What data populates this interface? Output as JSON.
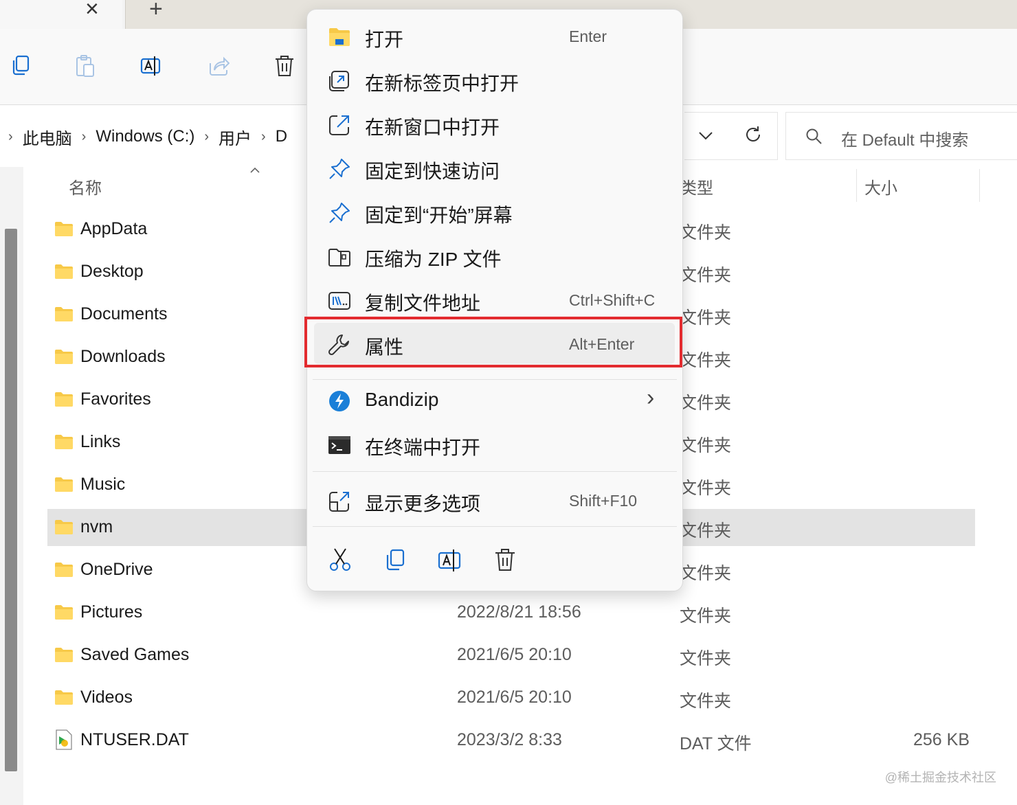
{
  "tabs": {
    "new_tab_symbol": "+",
    "close_symbol": "×"
  },
  "toolbar": {
    "icons": [
      "copy-icon",
      "paste-icon",
      "rename-icon",
      "share-icon",
      "delete-icon"
    ]
  },
  "address": {
    "crumbs": [
      "此电脑",
      "Windows (C:)",
      "用户",
      "D"
    ],
    "separator": "›",
    "search_placeholder": "在 Default 中搜索"
  },
  "columns": {
    "name": "名称",
    "type": "类型",
    "size": "大小"
  },
  "rows": [
    {
      "name": "AppData",
      "date": "",
      "type": "文件夹",
      "size": ""
    },
    {
      "name": "Desktop",
      "date": "",
      "type": "文件夹",
      "size": ""
    },
    {
      "name": "Documents",
      "date": "",
      "type": "文件夹",
      "size": ""
    },
    {
      "name": "Downloads",
      "date": "",
      "type": "文件夹",
      "size": ""
    },
    {
      "name": "Favorites",
      "date": "",
      "type": "文件夹",
      "size": ""
    },
    {
      "name": "Links",
      "date": "",
      "type": "文件夹",
      "size": ""
    },
    {
      "name": "Music",
      "date": "",
      "type": "文件夹",
      "size": ""
    },
    {
      "name": "nvm",
      "date": "",
      "type": "文件夹",
      "size": ""
    },
    {
      "name": "OneDrive",
      "date": "",
      "type": "文件夹",
      "size": ""
    },
    {
      "name": "Pictures",
      "date": "2022/8/21 18:56",
      "type": "文件夹",
      "size": ""
    },
    {
      "name": "Saved Games",
      "date": "2021/6/5 20:10",
      "type": "文件夹",
      "size": ""
    },
    {
      "name": "Videos",
      "date": "2021/6/5 20:10",
      "type": "文件夹",
      "size": ""
    },
    {
      "name": "NTUSER.DAT",
      "date": "2023/3/2 8:33",
      "type": "DAT 文件",
      "size": "256 KB"
    }
  ],
  "menu": {
    "items": [
      {
        "label": "打开",
        "shortcut": "Enter",
        "icon": "folder-icon"
      },
      {
        "label": "在新标签页中打开",
        "shortcut": "",
        "icon": "new-tab-icon"
      },
      {
        "label": "在新窗口中打开",
        "shortcut": "",
        "icon": "new-window-icon"
      },
      {
        "label": "固定到快速访问",
        "shortcut": "",
        "icon": "pin-icon"
      },
      {
        "label": "固定到“开始”屏幕",
        "shortcut": "",
        "icon": "pin-icon"
      },
      {
        "label": "压缩为 ZIP 文件",
        "shortcut": "",
        "icon": "zip-icon"
      },
      {
        "label": "复制文件地址",
        "shortcut": "Ctrl+Shift+C",
        "icon": "copy-path-icon"
      },
      {
        "label": "属性",
        "shortcut": "Alt+Enter",
        "icon": "wrench-icon"
      },
      {
        "label": "Bandizip",
        "shortcut": "",
        "icon": "bandizip-icon"
      },
      {
        "label": "在终端中打开",
        "shortcut": "",
        "icon": "terminal-icon"
      },
      {
        "label": "显示更多选项",
        "shortcut": "Shift+F10",
        "icon": "more-options-icon"
      }
    ],
    "submenu_arrow": "›",
    "bottom_actions": [
      "cut-icon",
      "copy-icon",
      "rename-icon",
      "delete-icon"
    ],
    "highlight_color": "#e32b2f"
  },
  "watermark": "@稀土掘金技术社区"
}
